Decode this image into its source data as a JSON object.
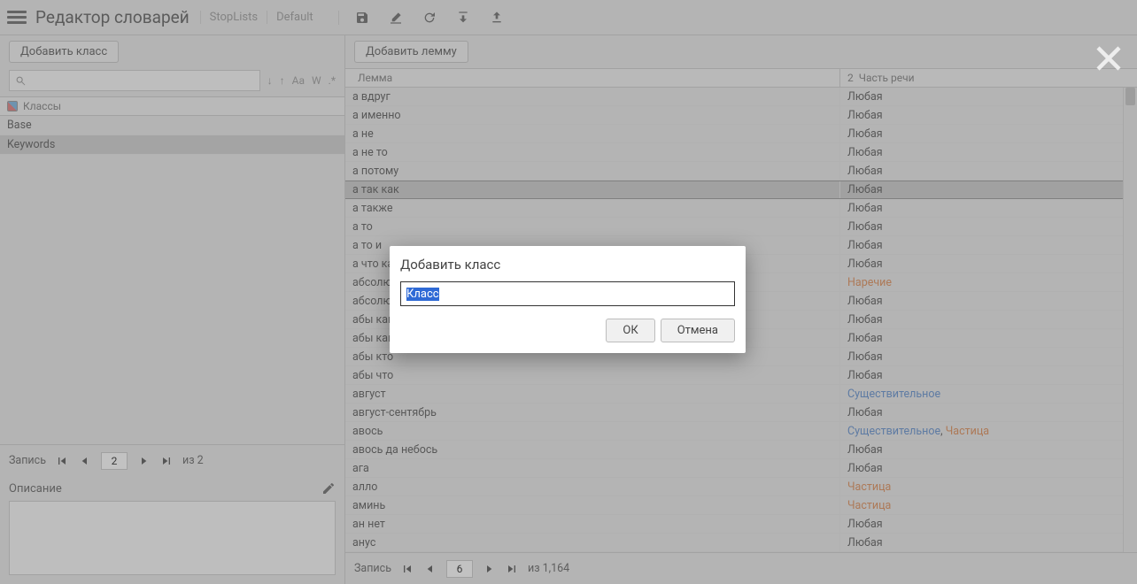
{
  "topbar": {
    "title": "Редактор словарей",
    "crumb1": "StopLists",
    "crumb2": "Default"
  },
  "left": {
    "add_class_btn": "Добавить класс",
    "classes_header": "Классы",
    "opt_aa": "Aa",
    "opt_w": "W",
    "opt_dot": ".*",
    "items": [
      {
        "name": "Base"
      },
      {
        "name": "Keywords"
      }
    ],
    "pager": {
      "label": "Запись",
      "page": "2",
      "of_label": "из 2"
    },
    "desc_label": "Описание"
  },
  "right": {
    "add_lemma_btn": "Добавить лемму",
    "col_lemma": "Лемма",
    "col_pos": "Часть речи",
    "col_pos_num": "2",
    "rows": [
      {
        "lemma": "а вдруг",
        "pos": "Любая",
        "cls": ""
      },
      {
        "lemma": "а именно",
        "pos": "Любая",
        "cls": ""
      },
      {
        "lemma": "а не",
        "pos": "Любая",
        "cls": ""
      },
      {
        "lemma": "а не то",
        "pos": "Любая",
        "cls": ""
      },
      {
        "lemma": "а потому",
        "pos": "Любая",
        "cls": ""
      },
      {
        "lemma": "а так как",
        "pos": "Любая",
        "cls": "",
        "sel": true
      },
      {
        "lemma": "а также",
        "pos": "Любая",
        "cls": ""
      },
      {
        "lemma": "а то",
        "pos": "Любая",
        "cls": ""
      },
      {
        "lemma": "а то и",
        "pos": "Любая",
        "cls": ""
      },
      {
        "lemma": "а что касается",
        "pos": "Любая",
        "cls": ""
      },
      {
        "lemma": "абсолютно",
        "pos": "Наречие",
        "cls": "pos-adv"
      },
      {
        "lemma": "абсолютный",
        "pos": "Любая",
        "cls": ""
      },
      {
        "lemma": "абы какой",
        "pos": "Любая",
        "cls": ""
      },
      {
        "lemma": "абы какой",
        "pos": "Любая",
        "cls": ""
      },
      {
        "lemma": "абы кто",
        "pos": "Любая",
        "cls": ""
      },
      {
        "lemma": "абы что",
        "pos": "Любая",
        "cls": ""
      },
      {
        "lemma": "август",
        "pos": "Существительное",
        "cls": "pos-noun"
      },
      {
        "lemma": "август-сентябрь",
        "pos": "Любая",
        "cls": ""
      },
      {
        "lemma": "авось",
        "pos_html": true,
        "pos1": "Существительное",
        "pos2": "Частица"
      },
      {
        "lemma": "авось да небось",
        "pos": "Любая",
        "cls": ""
      },
      {
        "lemma": "ага",
        "pos": "Любая",
        "cls": ""
      },
      {
        "lemma": "алло",
        "pos": "Частица",
        "cls": "pos-part"
      },
      {
        "lemma": "аминь",
        "pos": "Частица",
        "cls": "pos-part"
      },
      {
        "lemma": "ан нет",
        "pos": "Любая",
        "cls": ""
      },
      {
        "lemma": "анус",
        "pos": "Любая",
        "cls": ""
      }
    ],
    "pager": {
      "label": "Запись",
      "page": "6",
      "of_label": "из 1,164"
    }
  },
  "dialog": {
    "title": "Добавить класс",
    "value": "Класс",
    "ok": "ОК",
    "cancel": "Отмена"
  }
}
